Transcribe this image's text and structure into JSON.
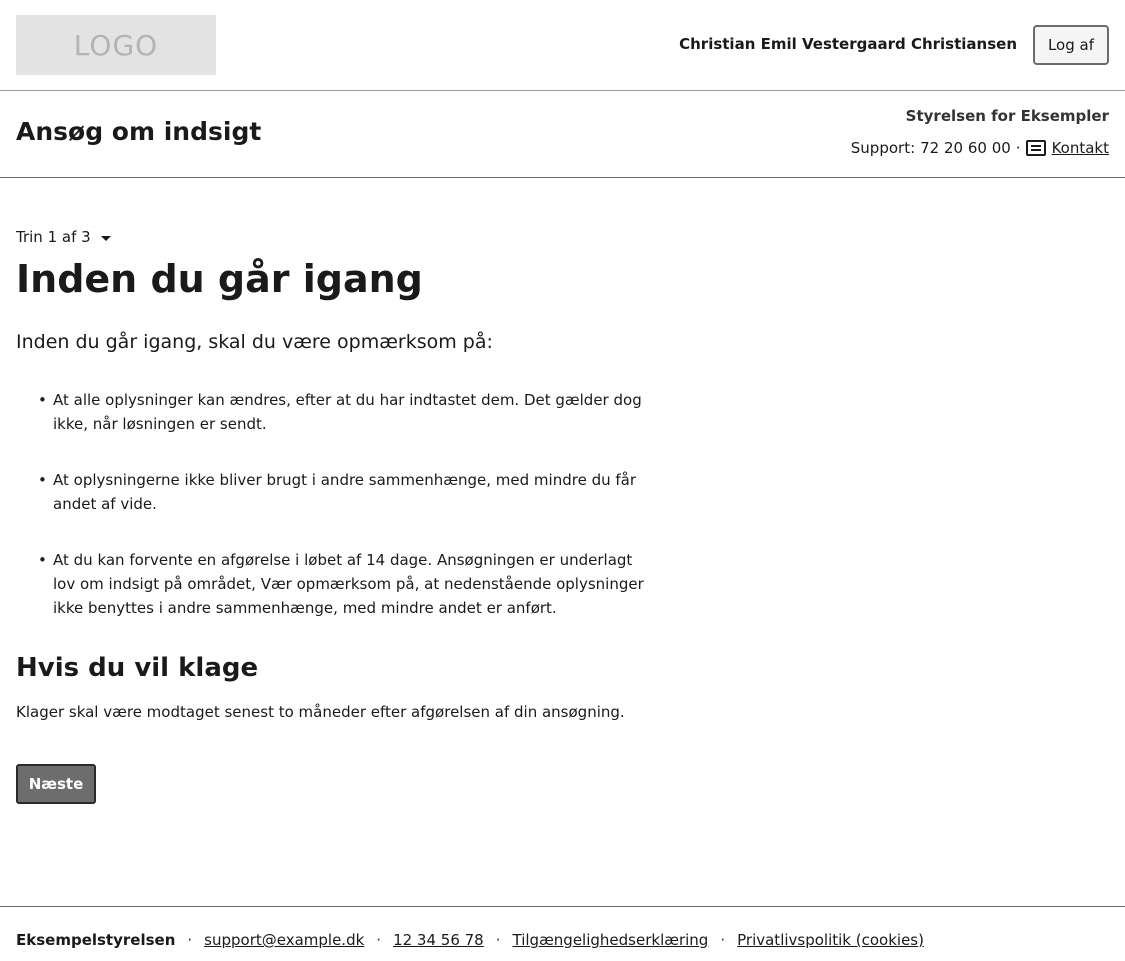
{
  "topbar": {
    "logo_text": "LOGO",
    "user_name": "Christian Emil Vestergaard Christiansen",
    "logout_label": "Log af"
  },
  "header": {
    "service_title": "Ansøg om indsigt",
    "authority": "Styrelsen for Eksempler",
    "support_label": "Support:",
    "support_phone": "72 20 60 00",
    "separator": "·",
    "contact_icon": "mail-icon",
    "contact_label": "Kontakt"
  },
  "main": {
    "step_label": "Trin 1 af 3",
    "step_icon": "caret-down-icon",
    "title": "Inden du går igang",
    "lead": "Inden du går igang, skal du være opmærksom på:",
    "bullets": [
      "At alle oplysninger kan ændres, efter at du har indtastet dem. Det gælder dog ikke, når løsningen er sendt.",
      "At oplysningerne ikke bliver brugt i andre sammenhænge, med mindre du får andet af vide.",
      "At du kan forvente en afgørelse i løbet af 14 dage. Ansøgningen er underlagt lov om indsigt på området, Vær opmærksom på, at nedenstående oplysninger ikke benyttes i andre sammenhænge, med mindre andet er anført."
    ],
    "complaint_title": "Hvis du vil klage",
    "complaint_text": "Klager skal være modtaget senest to måneder efter afgørelsen af din ansøgning.",
    "next_label": "Næste"
  },
  "footer": {
    "org": "Eksempelstyrelsen",
    "separator": "·",
    "email": "support@example.dk",
    "phone": "12 34 56 78",
    "accessibility": "Tilgængelighedserklæring",
    "privacy": "Privatlivspolitik (cookies)"
  }
}
